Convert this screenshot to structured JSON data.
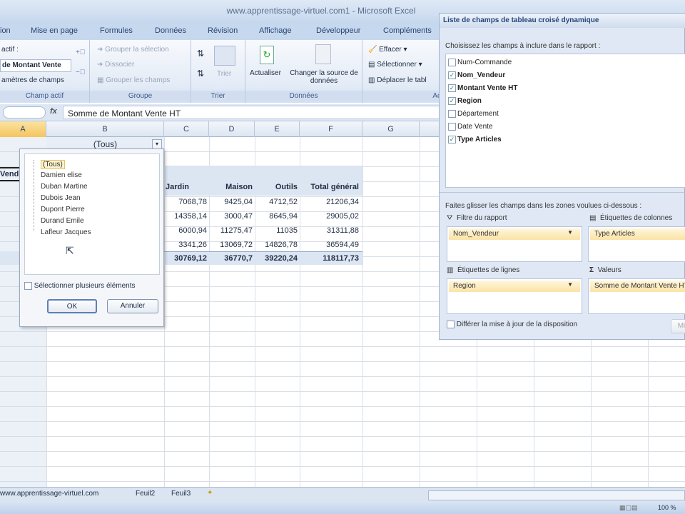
{
  "window": {
    "title": "www.apprentissage-virtuel.com1 - Microsoft Excel"
  },
  "tabs": [
    "ion",
    "Mise en page",
    "Formules",
    "Données",
    "Révision",
    "Affichage",
    "Développeur",
    "Compléments"
  ],
  "ribbon": {
    "champ_actif": {
      "label": "actif :",
      "value": "de Montant Vente",
      "params": "amètres de champs",
      "group": "Champ actif"
    },
    "groupe": {
      "items": [
        "Grouper la sélection",
        "Dissocier",
        "Grouper les champs"
      ],
      "group": "Groupe"
    },
    "trier": {
      "button": "Trier",
      "group": "Trier"
    },
    "donnees": {
      "refresh": "Actualiser",
      "change_source": "Changer la source de données",
      "group": "Données"
    },
    "actions": {
      "items": [
        "Effacer",
        "Sélectionner",
        "Déplacer le tabl"
      ],
      "group": "Ac"
    }
  },
  "formula_bar": {
    "fx": "fx",
    "value": "Somme de Montant Vente HT"
  },
  "columns": [
    "A",
    "B",
    "C",
    "D",
    "E",
    "F",
    "G"
  ],
  "sheet": {
    "filter_value": "(Tous)",
    "row_label_partial": "Vend",
    "headers": [
      "Jardin",
      "Maison",
      "Outils",
      "Total général"
    ],
    "rows": [
      [
        "7068,78",
        "9425,04",
        "4712,52",
        "21206,34"
      ],
      [
        "14358,14",
        "3000,47",
        "8645,94",
        "29005,02"
      ],
      [
        "6000,94",
        "11275,47",
        "11035",
        "31311,88"
      ],
      [
        "3341,26",
        "13069,72",
        "14826,78",
        "36594,49"
      ]
    ],
    "total": [
      "30769,12",
      "36770,7",
      "39220,24",
      "118117,73"
    ]
  },
  "filter_popup": {
    "items": [
      "(Tous)",
      "Damien elise",
      "Duban Martine",
      "Dubois Jean",
      "Dupont Pierre",
      "Durand Emile",
      "Lafleur Jacques"
    ],
    "multi_select": "Sélectionner plusieurs éléments",
    "ok": "OK",
    "cancel": "Annuler"
  },
  "field_list": {
    "title": "Liste de champs de tableau croisé dynamique",
    "choose_label": "Choisissez les champs à inclure dans le rapport :",
    "fields": [
      {
        "name": "Num-Commande",
        "checked": false
      },
      {
        "name": "Nom_Vendeur",
        "checked": true
      },
      {
        "name": "Montant Vente HT",
        "checked": true
      },
      {
        "name": "Region",
        "checked": true
      },
      {
        "name": "Département",
        "checked": false
      },
      {
        "name": "Date Vente",
        "checked": false
      },
      {
        "name": "Type Articles",
        "checked": true
      }
    ],
    "drag_label": "Faites glisser les champs dans les zones voulues ci-dessous :",
    "zones": {
      "filter": {
        "label": "Filtre du rapport",
        "item": "Nom_Vendeur"
      },
      "columns": {
        "label": "Étiquettes de colonnes",
        "item": "Type Articles"
      },
      "rows": {
        "label": "Étiquettes de lignes",
        "item": "Region"
      },
      "values": {
        "label": "Valeurs",
        "item": "Somme de Montant Vente HT"
      }
    },
    "defer_label": "Différer la mise à jour de la disposition",
    "update_button": "Mi"
  },
  "sheet_tabs": [
    "www.apprentissage-virtuel.com",
    "Feuil2",
    "Feuil3"
  ],
  "status": {
    "zoom": "100 %"
  }
}
